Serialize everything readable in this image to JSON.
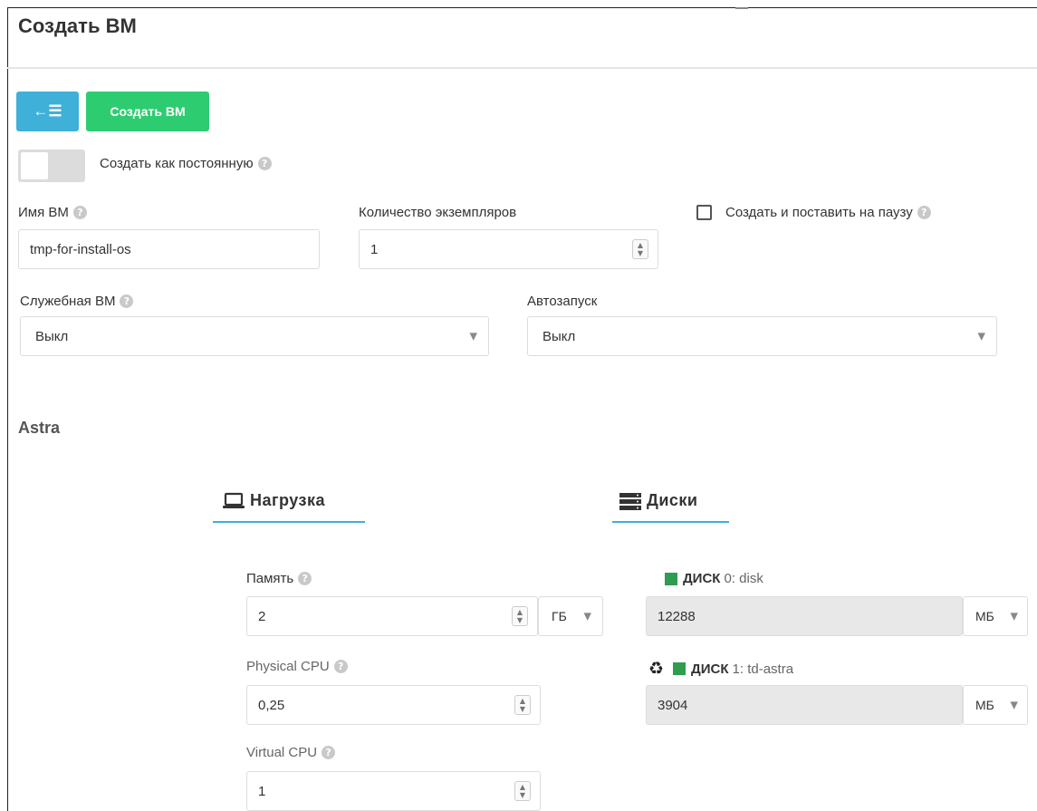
{
  "page": {
    "title": "Создать ВМ"
  },
  "toolbar": {
    "back_icon": "←☰",
    "create_label": "Создать ВМ"
  },
  "persistent": {
    "label": "Создать как постоянную",
    "checked": false
  },
  "vm_name": {
    "label": "Имя ВМ",
    "value": "tmp-for-install-os"
  },
  "instances": {
    "label": "Количество экземпляров",
    "value": "1"
  },
  "pause": {
    "label": "Создать и поставить на паузу",
    "checked": false
  },
  "service_vm": {
    "label": "Служебная ВМ",
    "value": "Выкл"
  },
  "autostart": {
    "label": "Автозапуск",
    "value": "Выкл"
  },
  "section": {
    "title": "Astra"
  },
  "tabs": {
    "load": "Нагрузка",
    "disks": "Диски"
  },
  "memory": {
    "label": "Память",
    "value": "2",
    "unit": "ГБ"
  },
  "physical_cpu": {
    "label": "Physical CPU",
    "value": "0,25"
  },
  "virtual_cpu": {
    "label": "Virtual CPU",
    "value": "1"
  },
  "disk0": {
    "caps": "ДИСК",
    "sub": "0: disk",
    "value": "12288",
    "unit": "МБ",
    "status_color": "#2e9d4f"
  },
  "disk1": {
    "caps": "ДИСК",
    "sub": "1: td-astra",
    "value": "3904",
    "unit": "МБ",
    "status_color": "#2e9d4f"
  },
  "colors": {
    "accent": "#3fb0d8",
    "success": "#2ecc71"
  }
}
